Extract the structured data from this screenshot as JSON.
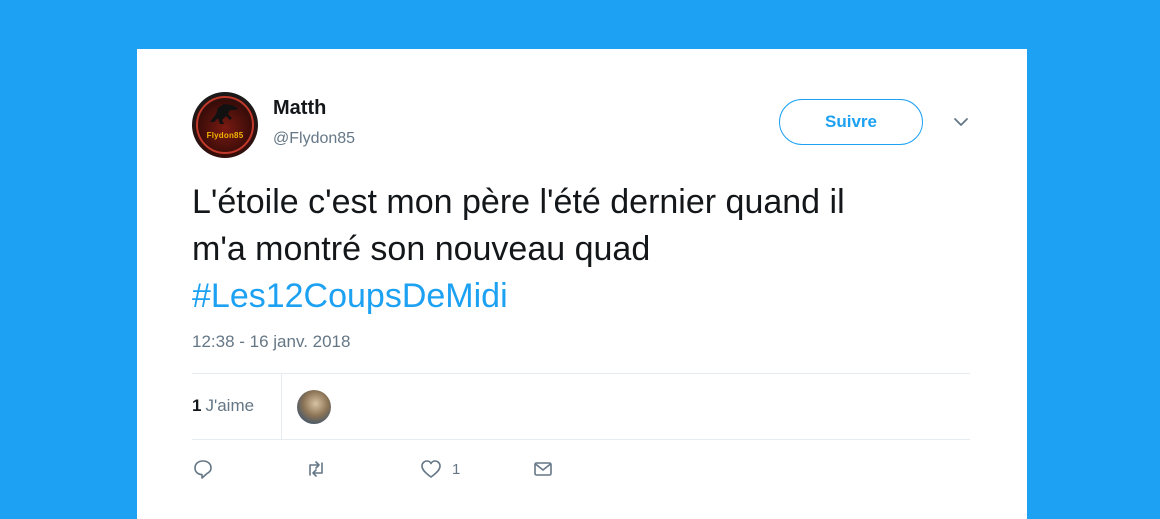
{
  "user": {
    "display_name": "Matth",
    "handle": "@Flydon85",
    "avatar_text": "Flydon85"
  },
  "follow_button": {
    "label": "Suivre"
  },
  "tweet": {
    "line1": "L'étoile c'est mon père l'été dernier quand il",
    "line2": "m'a montré son nouveau quad",
    "hashtag": "#Les12CoupsDeMidi",
    "timestamp": "12:38 - 16 janv. 2018"
  },
  "stats": {
    "likes_count": "1",
    "likes_label": "J'aime"
  },
  "actions": {
    "reply": {
      "icon": "reply-icon"
    },
    "retweet": {
      "icon": "retweet-icon"
    },
    "like": {
      "icon": "heart-icon",
      "count": "1"
    },
    "dm": {
      "icon": "envelope-icon"
    }
  },
  "colors": {
    "background": "#1da1f2",
    "accent": "#1da1f2",
    "text": "#14171a",
    "muted": "#657786"
  }
}
